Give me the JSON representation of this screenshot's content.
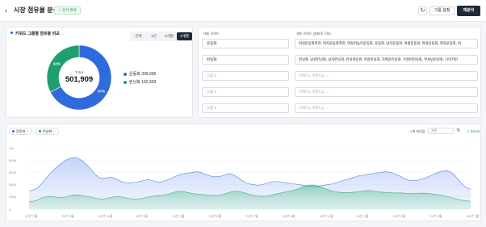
{
  "header": {
    "back_icon": "chevron-left-icon",
    "title": "시장 점유율 분석",
    "badge": "✓ 분석 완료",
    "refresh_icon": "refresh-icon",
    "group_settings_label": "그룹 설정",
    "reanalyze_label": "재분석"
  },
  "share_panel": {
    "title": "키워드 그룹별 점유율 비교",
    "periods": [
      "전체",
      "1년",
      "6개월",
      "3개월"
    ],
    "active_period": "3개월",
    "donut": {
      "total_label": "Total",
      "total_value": "501,909",
      "segments": [
        {
          "name": "운동화",
          "value": 339006,
          "display_value": "339,006",
          "percent_label": "67%",
          "color": "#2f6bdc"
        },
        {
          "name": "런닝화",
          "value": 162903,
          "display_value": "162,903",
          "percent_label": "32%",
          "color": "#1f9e6e"
        }
      ]
    }
  },
  "keyword_panel": {
    "col_rep": "대표 키워드",
    "col_sub": "세부 키워드 (쉼표로 구분)",
    "rows": [
      {
        "rep": "운동화",
        "sub": "여성운동화추천, 여자운동화추천, 여성키높이운동화, 운동화, 남자운동화, 여름운동화, 여성운동화, 여자운동화, 여"
      },
      {
        "rep": "런닝화",
        "sub": "런닝화, 남성런닝화, 남자런닝화, 런닝화순위, 여성런닝화, 가벼운런닝화, 가성비런닝화, 쿠셔닝런닝화, 나이키런"
      },
      {
        "rep": "그룹 3",
        "sub": "키워드1, 키워드2, ..."
      },
      {
        "rep": "그룹 4",
        "sub": "키워드1, 키워드2, ..."
      },
      {
        "rep": "그룹 5",
        "sub": "키워드1, 키워드2, ..."
      }
    ]
  },
  "trend_chart": {
    "chips": [
      {
        "label": "운동화",
        "color": "#2f6bdc"
      },
      {
        "label": "런닝화",
        "color": "#1f9e6e"
      }
    ],
    "y_axis_label": "Y축 최대값",
    "y_axis_placeholder": "자동",
    "excel_label": "⇩ Excel"
  },
  "chart_data": {
    "type": "area",
    "y_ticks": [
      "1M",
      "800K",
      "600K",
      "400K",
      "200K",
      "0"
    ],
    "x_ticks": [
      "22년 7월",
      "22년 9월",
      "22년 11월",
      "23년 1월",
      "23년 3월",
      "23년 5월",
      "23년 7월",
      "23년 9월",
      "23년 11월",
      "24년 1월",
      "24년 3월",
      "24년 5월",
      "24년 7월"
    ],
    "ylim": [
      0,
      1000000
    ],
    "x_count": 109,
    "series": [
      {
        "name": "운동화",
        "color": "#2f6bdc",
        "values": [
          300000,
          315000,
          340000,
          410000,
          490000,
          570000,
          640000,
          700000,
          750000,
          800000,
          830000,
          845000,
          830000,
          790000,
          730000,
          660000,
          580000,
          520000,
          500000,
          510000,
          520000,
          500000,
          470000,
          440000,
          430000,
          430000,
          440000,
          450000,
          470000,
          480000,
          470000,
          450000,
          440000,
          460000,
          480000,
          510000,
          540000,
          570000,
          580000,
          590000,
          600000,
          610000,
          600000,
          570000,
          550000,
          530000,
          530000,
          540000,
          560000,
          580000,
          560000,
          520000,
          470000,
          430000,
          410000,
          400000,
          390000,
          400000,
          420000,
          440000,
          450000,
          450000,
          440000,
          430000,
          420000,
          410000,
          400000,
          390000,
          380000,
          370000,
          370000,
          380000,
          390000,
          400000,
          410000,
          430000,
          450000,
          470000,
          490000,
          510000,
          530000,
          550000,
          560000,
          570000,
          580000,
          590000,
          600000,
          610000,
          605000,
          590000,
          560000,
          530000,
          490000,
          470000,
          465000,
          470000,
          490000,
          510000,
          540000,
          570000,
          600000,
          620000,
          630000,
          610000,
          560000,
          480000,
          400000,
          350000,
          320000
        ]
      },
      {
        "name": "런닝화",
        "color": "#1f9e6e",
        "values": [
          120000,
          130000,
          150000,
          180000,
          200000,
          210000,
          205000,
          195000,
          190000,
          200000,
          220000,
          235000,
          230000,
          220000,
          210000,
          200000,
          185000,
          170000,
          165000,
          175000,
          190000,
          205000,
          205000,
          195000,
          180000,
          170000,
          165000,
          170000,
          180000,
          195000,
          210000,
          220000,
          225000,
          230000,
          240000,
          265000,
          285000,
          290000,
          285000,
          270000,
          255000,
          245000,
          240000,
          235000,
          230000,
          225000,
          225000,
          230000,
          250000,
          275000,
          290000,
          295000,
          280000,
          260000,
          240000,
          225000,
          215000,
          210000,
          215000,
          225000,
          240000,
          255000,
          270000,
          285000,
          300000,
          315000,
          340000,
          365000,
          385000,
          395000,
          390000,
          370000,
          345000,
          320000,
          300000,
          285000,
          275000,
          270000,
          270000,
          275000,
          280000,
          290000,
          300000,
          305000,
          300000,
          290000,
          280000,
          275000,
          270000,
          265000,
          265000,
          265000,
          260000,
          255000,
          255000,
          258000,
          262000,
          260000,
          255000,
          245000,
          235000,
          225000,
          210000,
          195000,
          175000,
          160000,
          145000,
          135000,
          130000
        ]
      }
    ]
  }
}
